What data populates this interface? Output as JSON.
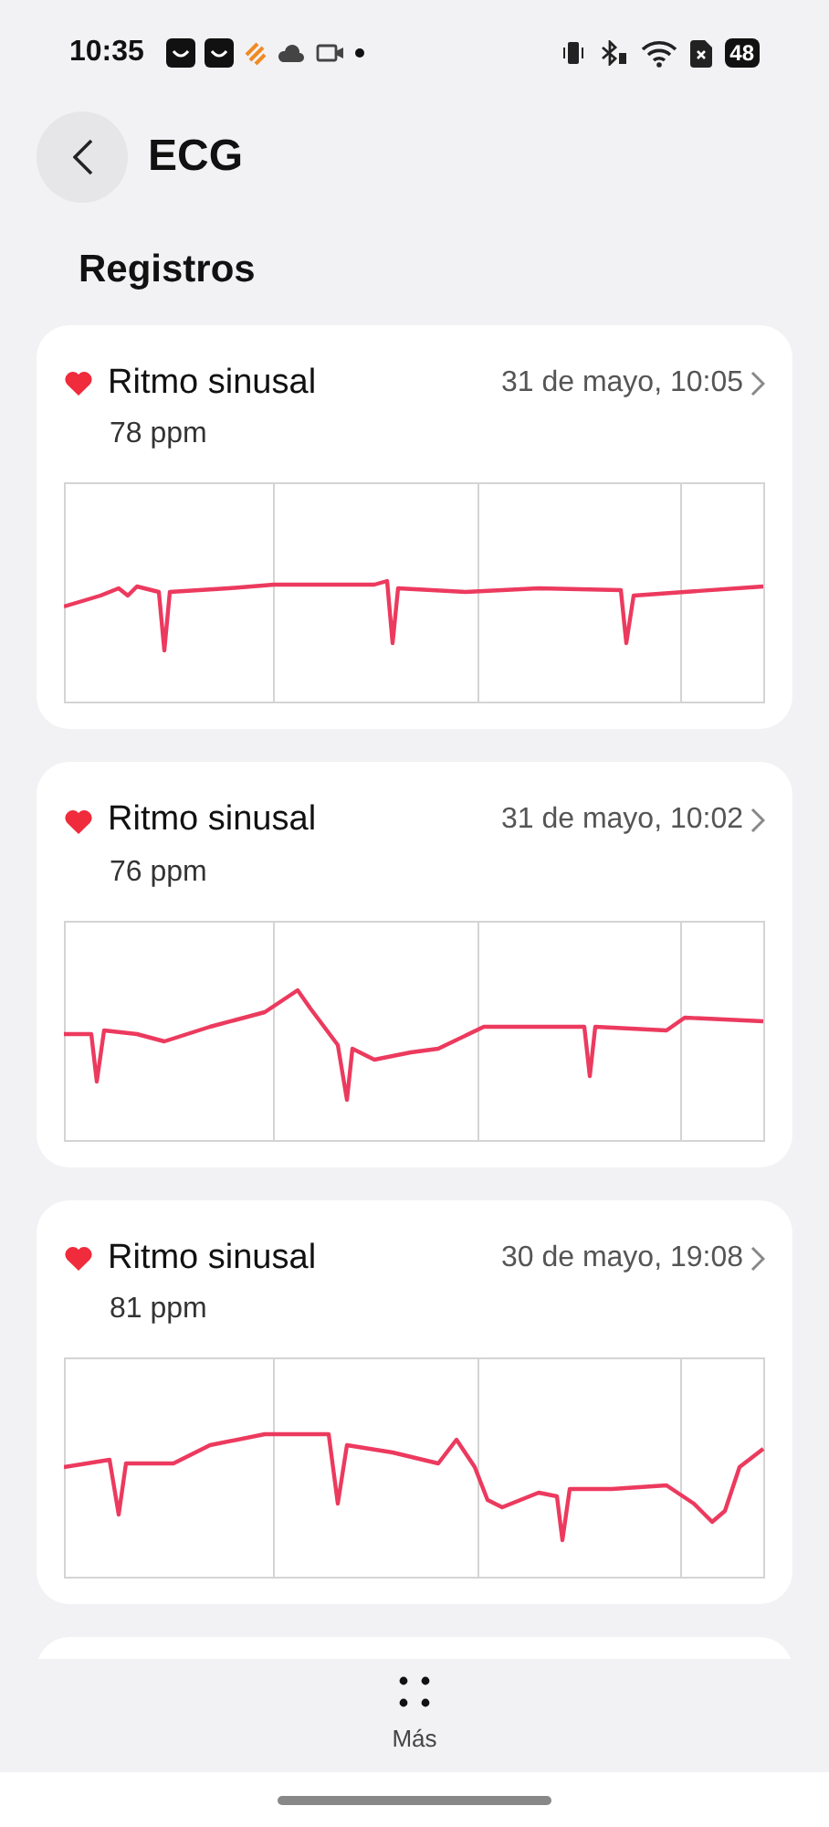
{
  "status_bar": {
    "time": "10:35",
    "battery": "48"
  },
  "header": {
    "title": "ECG"
  },
  "section_title": "Registros",
  "records": [
    {
      "rhythm": "Ritmo sinusal",
      "date": "31 de mayo, 10:05",
      "bpm": "78 ppm"
    },
    {
      "rhythm": "Ritmo sinusal",
      "date": "31 de mayo, 10:02",
      "bpm": "76 ppm"
    },
    {
      "rhythm": "Ritmo sinusal",
      "date": "30 de mayo, 19:08",
      "bpm": "81 ppm"
    }
  ],
  "bottom_nav": {
    "label": "Más"
  }
}
